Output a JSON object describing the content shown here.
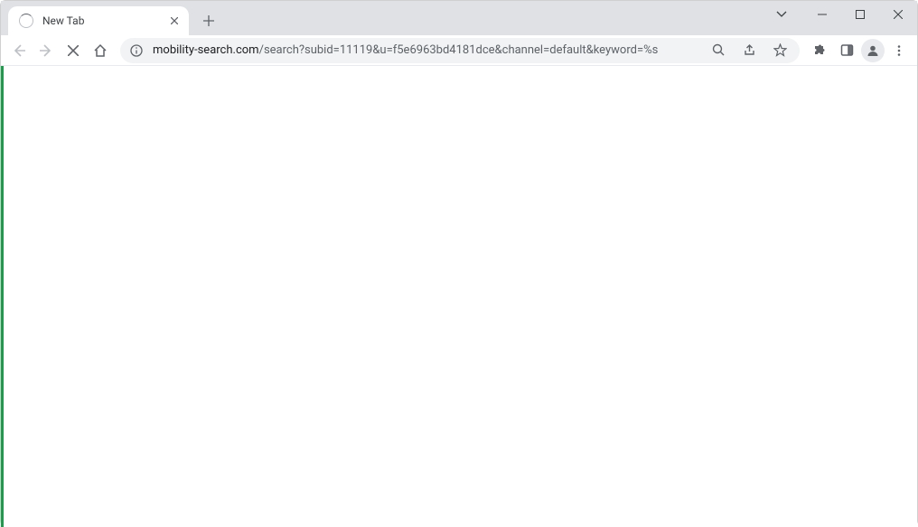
{
  "tab": {
    "title": "New Tab"
  },
  "url": {
    "domain": "mobility-search.com",
    "path": "/search?subid=11119&u=f5e6963bd4181dce&channel=default&keyword=%s"
  }
}
